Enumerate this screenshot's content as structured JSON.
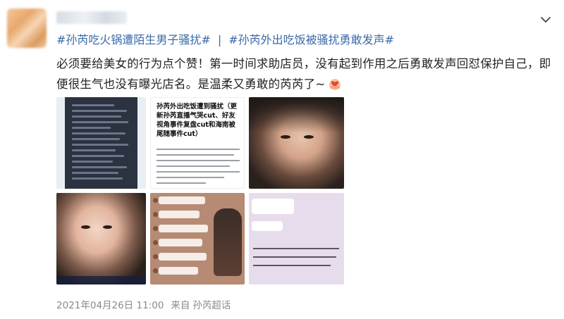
{
  "post": {
    "topics": [
      "#孙芮吃火锅遭陌生男子骚扰#",
      "#孙芮外出吃饭被骚扰勇敢发声#"
    ],
    "separator": "|",
    "text": "必须要给美女的行为点个赞！第一时间求助店员，没有起到作用之后勇敢发声回怼保护自己，即便很生气也没有曝光店名。是温柔又勇敢的芮芮了~",
    "emoji": "heart-hands-emoji",
    "image2_title": "孙芮外出吃饭遭到骚扰（更新孙芮直播气哭cut、好友视角事件复盘cut和海南被尾随事件cut）",
    "date": "2021年04月26日 11:00",
    "source_prefix": "来自",
    "source": "孙芮超话"
  },
  "icons": {
    "menu": "chevron-down-icon"
  },
  "colors": {
    "link": "#3a6aa8",
    "meta": "#8a8a8a",
    "text": "#222222"
  }
}
